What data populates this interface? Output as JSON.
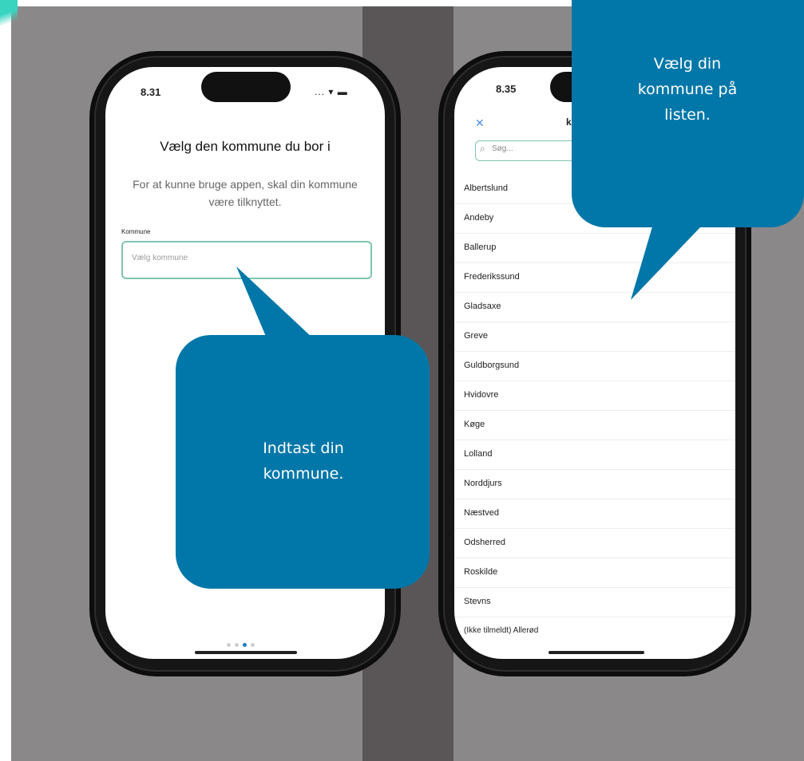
{
  "colors": {
    "background": "#8b8889",
    "divider": "#5a5658",
    "bubble": "#0077a8",
    "field_border": "#7fc4b0",
    "accent": "#4a90d9"
  },
  "left_phone": {
    "time": "8.31",
    "status": "... ▾ ▬",
    "title": "Vælg den kommune du bor i",
    "subtitle": "For at kunne bruge appen, skal din kommune være tilknyttet.",
    "field_label": "Kommune",
    "field_placeholder": "Vælg kommune",
    "page_indicator": {
      "count": 4,
      "active_index": 2
    }
  },
  "right_phone": {
    "time": "8.35",
    "close_icon": "close-icon",
    "header_fragment": "k",
    "search_placeholder": "Søg...",
    "municipalities": [
      "Albertslund",
      "Andeby",
      "Ballerup",
      "Frederikssund",
      "Gladsaxe",
      "Greve",
      "Guldborgsund",
      "Hvidovre",
      "Køge",
      "Lolland",
      "Norddjurs",
      "Næstved",
      "Odsherred",
      "Roskilde",
      "Stevns"
    ],
    "last_row": "(Ikke tilmeldt) Allerød"
  },
  "callouts": {
    "left": "Indtast din kommune.",
    "right": "Vælg din kommune på listen."
  }
}
